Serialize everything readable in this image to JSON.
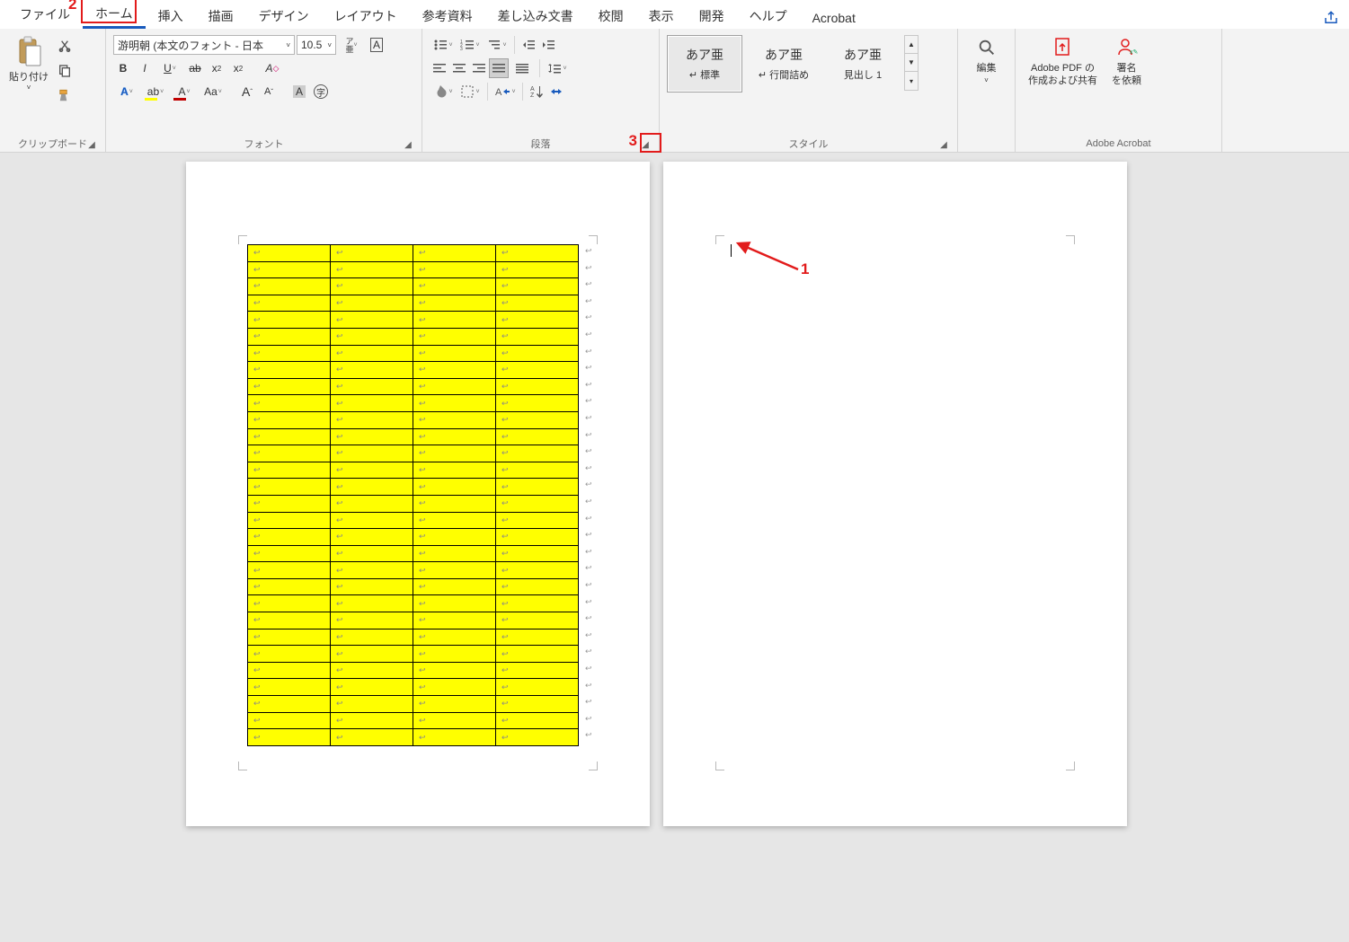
{
  "tabs": {
    "file": "ファイル",
    "home": "ホーム",
    "insert": "挿入",
    "draw": "描画",
    "design": "デザイン",
    "layout": "レイアウト",
    "references": "参考資料",
    "mailings": "差し込み文書",
    "review": "校閲",
    "view": "表示",
    "developer": "開発",
    "help": "ヘルプ",
    "acrobat": "Acrobat"
  },
  "clipboard": {
    "paste": "貼り付け",
    "group": "クリップボード"
  },
  "font": {
    "name": "游明朝 (本文のフォント - 日本",
    "size": "10.5",
    "ruby": "ア亜",
    "group": "フォント"
  },
  "paragraph": {
    "group": "段落"
  },
  "styles": {
    "group": "スタイル",
    "s1_preview": "あア亜",
    "s1_name": "↵ 標準",
    "s2_preview": "あア亜",
    "s2_name": "↵ 行間詰め",
    "s3_preview": "あア亜",
    "s3_name": "見出し 1"
  },
  "edit": {
    "label": "編集"
  },
  "acrobat_group": {
    "pdf_l1": "Adobe PDF の",
    "pdf_l2": "作成および共有",
    "sign_l1": "署名",
    "sign_l2": "を依頼",
    "group": "Adobe Acrobat"
  },
  "annotations": {
    "n1": "1",
    "n2": "2",
    "n3": "3"
  },
  "table": {
    "rows": 30,
    "cols": 4,
    "cell_mark": "↩",
    "row_end_mark": "↩"
  },
  "colors": {
    "accent": "#185abd",
    "highlight": "#ffff00",
    "fontcolor": "#c00000",
    "anno": "#e21b1b"
  }
}
